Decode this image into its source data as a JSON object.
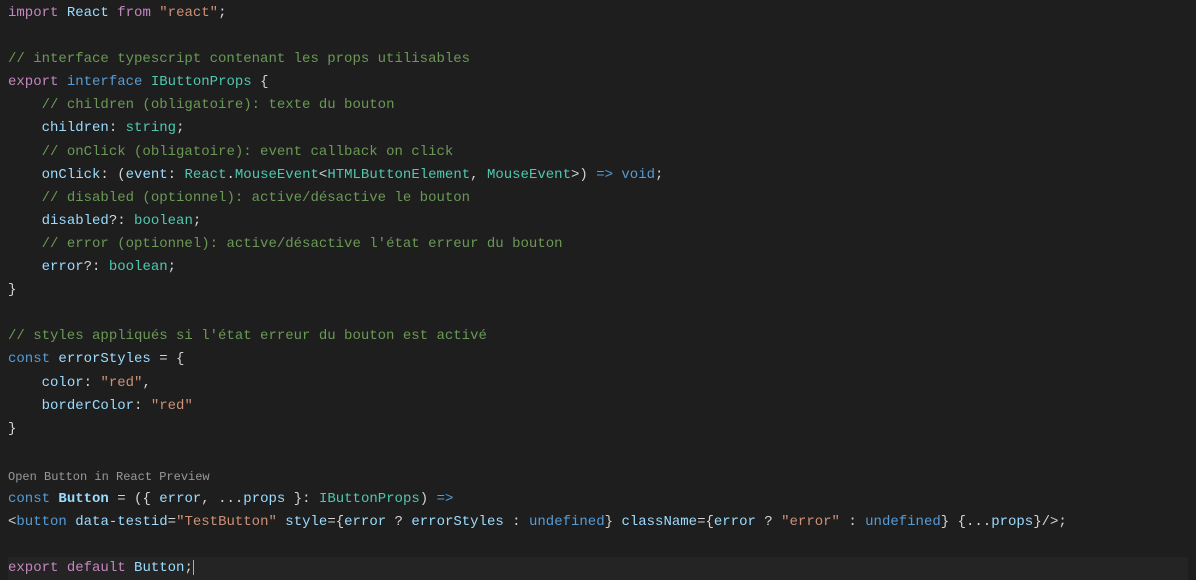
{
  "editor": {
    "codelens": "Open Button in React Preview",
    "tokens": {
      "l1": {
        "import": "import",
        "React": "React",
        "from": "from",
        "reactStr": "\"react\""
      },
      "l3": {
        "comment": "// interface typescript contenant les props utilisables"
      },
      "l4": {
        "export": "export",
        "interface": "interface",
        "name": "IButtonProps",
        "brace": " {"
      },
      "l5": {
        "comment": "// children (obligatoire): texte du bouton"
      },
      "l6": {
        "prop": "children",
        "colon": ":",
        "type": "string",
        "semi": ";"
      },
      "l7": {
        "comment": "// onClick (obligatoire): event callback on click"
      },
      "l8": {
        "prop": "onClick",
        "colon": ":",
        "open": " (",
        "param": "event",
        "colon2": ":",
        "t1": "React",
        "dot": ".",
        "t2": "MouseEvent",
        "lt": "<",
        "t3": "HTMLButtonElement",
        "comma": ",",
        "t4": "MouseEvent",
        "gt": ">) ",
        "arrow": "=>",
        "ret": "void",
        "semi": ";"
      },
      "l9": {
        "comment": "// disabled (optionnel): active/désactive le bouton"
      },
      "l10": {
        "prop": "disabled",
        "q": "?",
        "colon": ":",
        "type": "boolean",
        "semi": ";"
      },
      "l11": {
        "comment": "// error (optionnel): active/désactive l'état erreur du bouton"
      },
      "l12": {
        "prop": "error",
        "q": "?",
        "colon": ":",
        "type": "boolean",
        "semi": ";"
      },
      "l13": {
        "brace": "}"
      },
      "l15": {
        "comment": "// styles appliqués si l'état erreur du bouton est activé"
      },
      "l16": {
        "const": "const",
        "name": "errorStyles",
        "eq": " = {"
      },
      "l17": {
        "prop": "color",
        "colon": ":",
        "val": "\"red\"",
        "comma": ","
      },
      "l18": {
        "prop": "borderColor",
        "colon": ":",
        "val": "\"red\""
      },
      "l19": {
        "brace": "}"
      },
      "l21": {
        "const": "const",
        "name": "Button",
        "eq": " = ({ ",
        "p1": "error",
        "comma": ", ...",
        "p2": "props",
        "close": " }",
        "colon": ":",
        "type": "IButtonProps",
        "paren": ") ",
        "arrow": "=>"
      },
      "l22": {
        "open": "<",
        "tag": "button",
        "a1": "data-testid",
        "eq1": "=",
        "v1": "\"TestButton\"",
        "a2": "style",
        "eq2": "=",
        "ob": "{",
        "e1": "error",
        "q": " ? ",
        "e2": "errorStyles",
        "c": " : ",
        "e3": "undefined",
        "cb": "}",
        "a3": "className",
        "eq3": "=",
        "ob2": "{",
        "e4": "error",
        "q2": " ? ",
        "v2": "\"error\"",
        "c2": " : ",
        "e5": "undefined",
        "cb2": "}",
        "spread": " {...",
        "p": "props",
        "cb3": "}",
        "close": "/>;"
      },
      "l24": {
        "export": "export",
        "default": "default",
        "name": "Button",
        "semi": ";"
      }
    }
  }
}
